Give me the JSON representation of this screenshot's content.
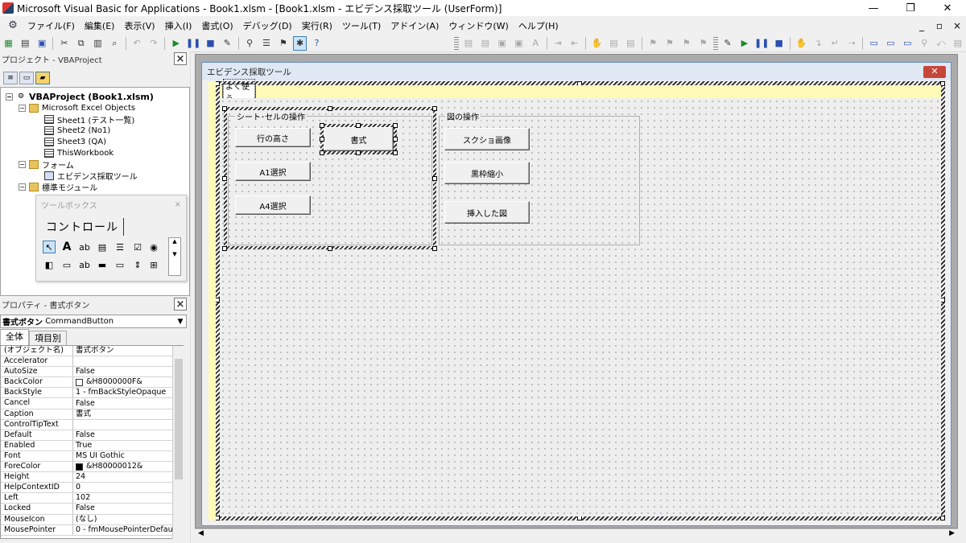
{
  "window": {
    "title": "Microsoft Visual Basic for Applications - Book1.xlsm - [Book1.xlsm - エビデンス採取ツール (UserForm)]",
    "min": "—",
    "max": "❐",
    "close": "✕"
  },
  "menu": [
    "ファイル(F)",
    "編集(E)",
    "表示(V)",
    "挿入(I)",
    "書式(O)",
    "デバッグ(D)",
    "実行(R)",
    "ツール(T)",
    "アドイン(A)",
    "ウィンドウ(W)",
    "ヘルプ(H)"
  ],
  "mdi_controls": {
    "min": "_",
    "restore": "▫",
    "close": "×"
  },
  "project": {
    "header": "プロジェクト - VBAProject",
    "close": "×",
    "tree": [
      {
        "label": "VBAProject (Book1.xlsm)"
      },
      {
        "label": "Microsoft Excel Objects"
      },
      {
        "label": "Sheet1 (テスト一覧)"
      },
      {
        "label": "Sheet2 (No1)"
      },
      {
        "label": "Sheet3 (QA)"
      },
      {
        "label": "ThisWorkbook"
      },
      {
        "label": "フォーム"
      },
      {
        "label": "エビデンス採取ツール"
      },
      {
        "label": "標準モジュール"
      }
    ]
  },
  "toolbox": {
    "title": "ツールボックス",
    "close": "×",
    "tab": "コントロール"
  },
  "properties": {
    "header": "プロパティ - 書式ボタン",
    "close": "×",
    "object_name": "書式ボタン",
    "object_type": "CommandButton",
    "tab_all": "全体",
    "tab_category": "項目別",
    "rows": [
      {
        "name": "(オブジェクト名)",
        "value": "書式ボタン"
      },
      {
        "name": "Accelerator",
        "value": ""
      },
      {
        "name": "AutoSize",
        "value": "False"
      },
      {
        "name": "BackColor",
        "value": "&H8000000F&",
        "swatch": "#ffffff"
      },
      {
        "name": "BackStyle",
        "value": "1 - fmBackStyleOpaque"
      },
      {
        "name": "Cancel",
        "value": "False"
      },
      {
        "name": "Caption",
        "value": "書式"
      },
      {
        "name": "ControlTipText",
        "value": ""
      },
      {
        "name": "Default",
        "value": "False"
      },
      {
        "name": "Enabled",
        "value": "True"
      },
      {
        "name": "Font",
        "value": "MS UI Gothic"
      },
      {
        "name": "ForeColor",
        "value": "&H80000012&",
        "swatch": "#000000"
      },
      {
        "name": "Height",
        "value": "24"
      },
      {
        "name": "HelpContextID",
        "value": "0"
      },
      {
        "name": "Left",
        "value": "102"
      },
      {
        "name": "Locked",
        "value": "False"
      },
      {
        "name": "MouseIcon",
        "value": "(なし)"
      },
      {
        "name": "MousePointer",
        "value": "0 - fmMousePointerDefau"
      }
    ]
  },
  "form": {
    "title": "エビデンス採取ツール",
    "close": "✕",
    "page_tab": "よく使う",
    "frame1": {
      "caption": "シート･セルの操作",
      "buttons": [
        "行の高さ",
        "書式",
        "A1選択",
        "A4選択"
      ]
    },
    "frame2": {
      "caption": "図の操作",
      "buttons": [
        "スクショ画像",
        "黒枠縮小",
        "挿入した図"
      ]
    }
  },
  "colors": {
    "selection_blue": "#cce4f7",
    "yellow_band": "#fdfbb6",
    "form_close": "#c7463a"
  }
}
